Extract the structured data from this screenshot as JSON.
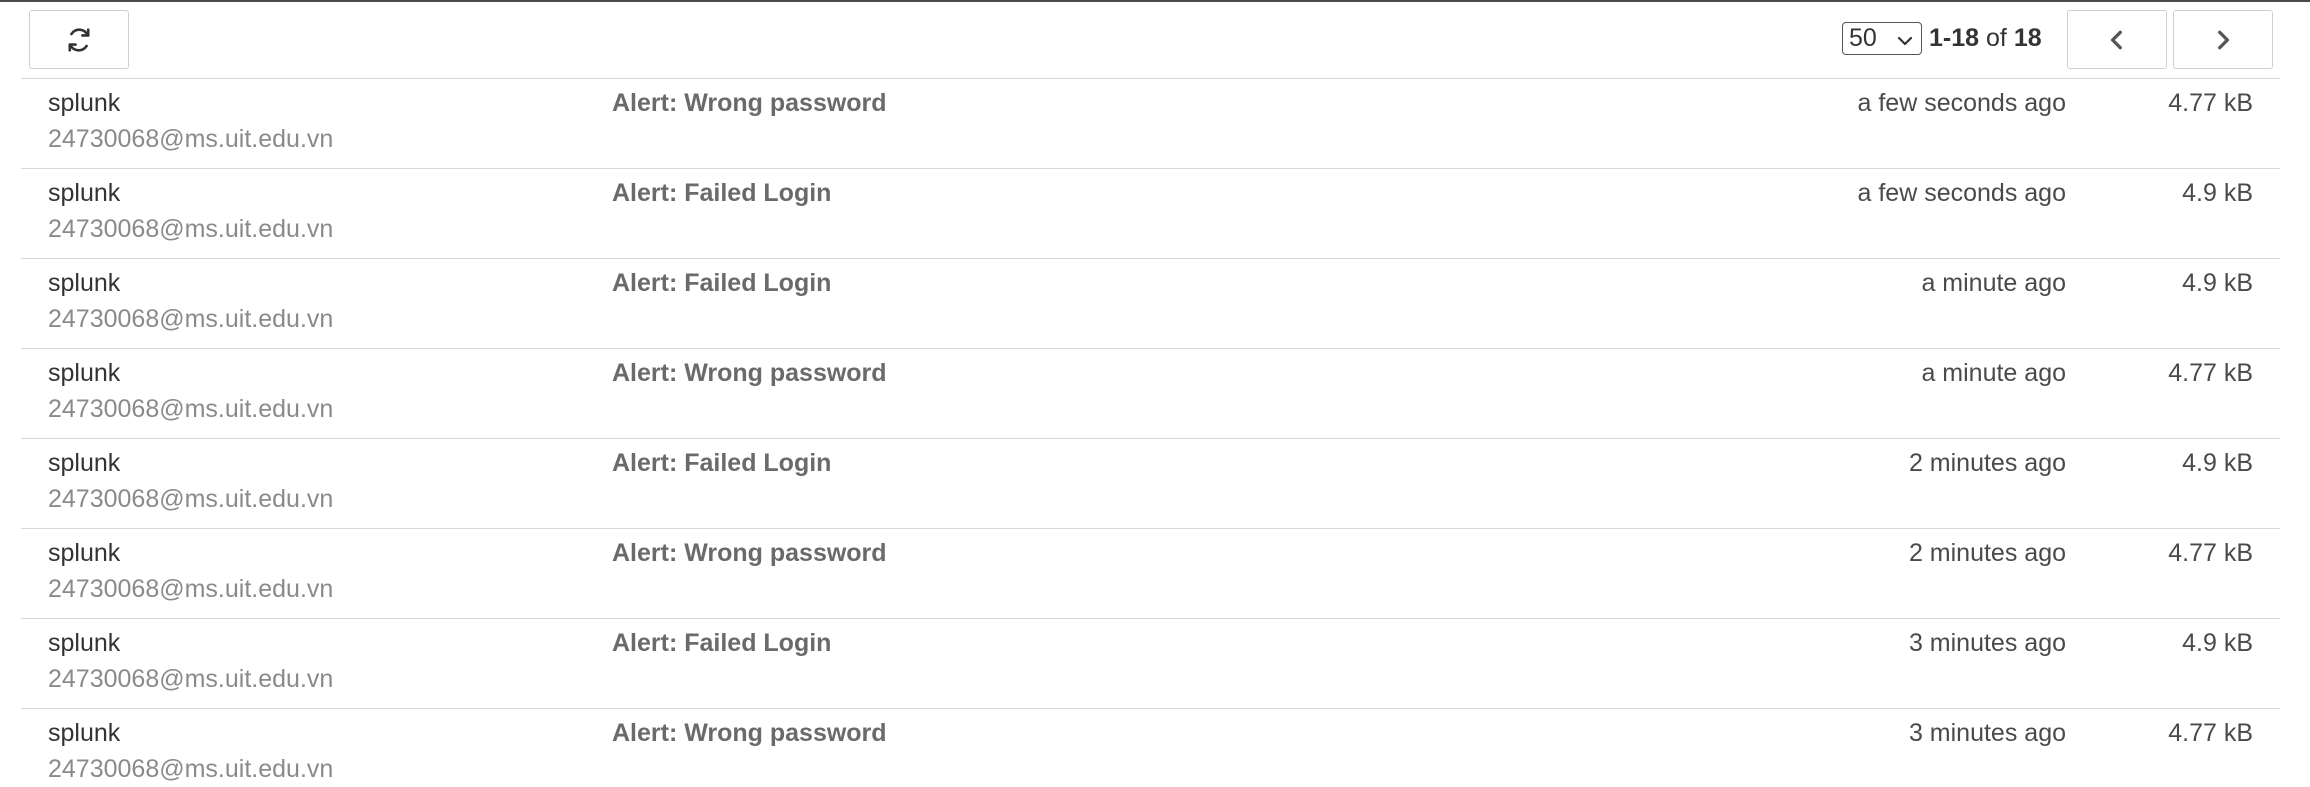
{
  "toolbar": {
    "refresh_icon": "refresh-icon",
    "page_size": "50",
    "page_size_options": [
      "50"
    ],
    "range_start_end": "1-18",
    "range_of": "of",
    "range_total": "18",
    "prev_icon": "chevron-left-icon",
    "next_icon": "chevron-right-icon"
  },
  "messages": [
    {
      "sender": "splunk",
      "email": "24730068@ms.uit.edu.vn",
      "subject": "Alert: Wrong password",
      "time": "a few seconds ago",
      "size": "4.77 kB"
    },
    {
      "sender": "splunk",
      "email": "24730068@ms.uit.edu.vn",
      "subject": "Alert: Failed Login",
      "time": "a few seconds ago",
      "size": "4.9 kB"
    },
    {
      "sender": "splunk",
      "email": "24730068@ms.uit.edu.vn",
      "subject": "Alert: Failed Login",
      "time": "a minute ago",
      "size": "4.9 kB"
    },
    {
      "sender": "splunk",
      "email": "24730068@ms.uit.edu.vn",
      "subject": "Alert: Wrong password",
      "time": "a minute ago",
      "size": "4.77 kB"
    },
    {
      "sender": "splunk",
      "email": "24730068@ms.uit.edu.vn",
      "subject": "Alert: Failed Login",
      "time": "2 minutes ago",
      "size": "4.9 kB"
    },
    {
      "sender": "splunk",
      "email": "24730068@ms.uit.edu.vn",
      "subject": "Alert: Wrong password",
      "time": "2 minutes ago",
      "size": "4.77 kB"
    },
    {
      "sender": "splunk",
      "email": "24730068@ms.uit.edu.vn",
      "subject": "Alert: Failed Login",
      "time": "3 minutes ago",
      "size": "4.9 kB"
    },
    {
      "sender": "splunk",
      "email": "24730068@ms.uit.edu.vn",
      "subject": "Alert: Wrong password",
      "time": "3 minutes ago",
      "size": "4.77 kB"
    }
  ]
}
